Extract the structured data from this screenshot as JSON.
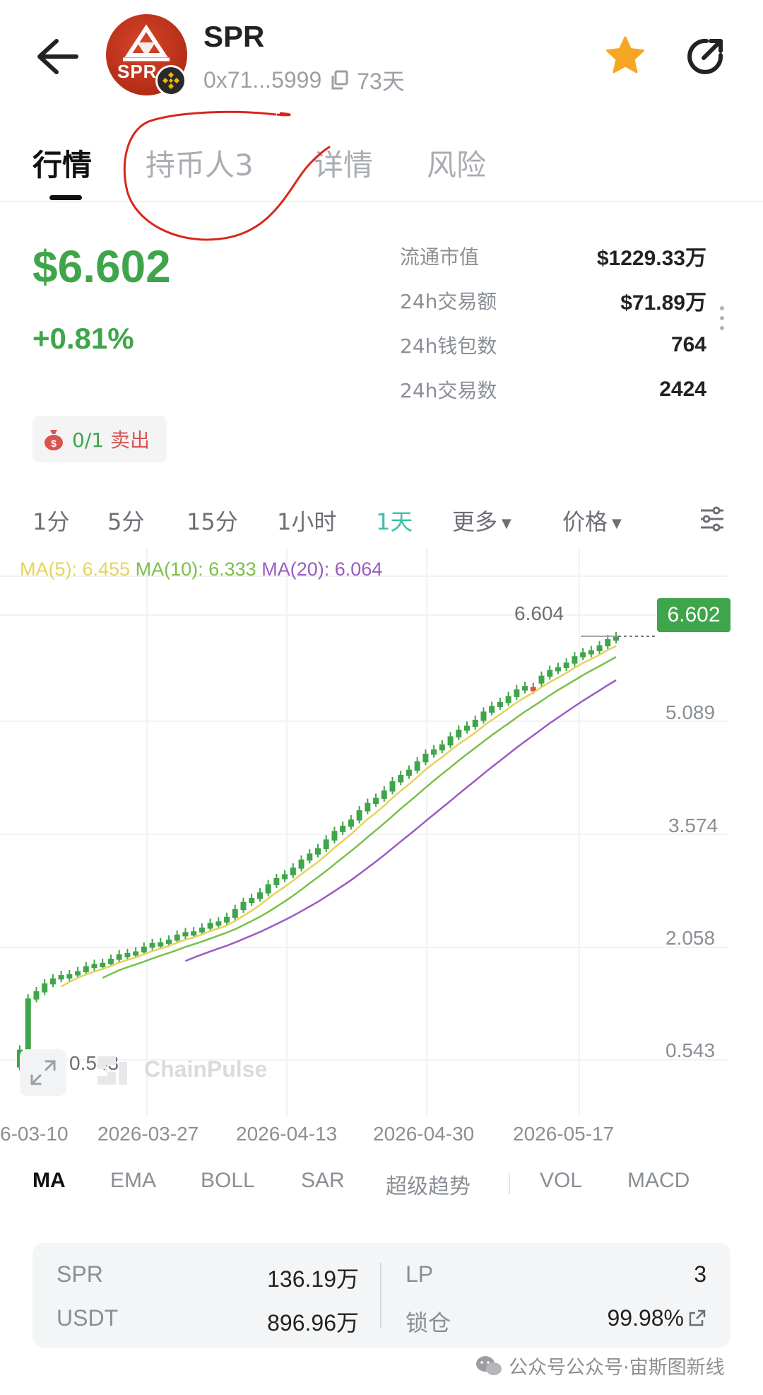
{
  "header": {
    "token_symbol": "SPR",
    "avatar_text": "SPR",
    "address": "0x71...5999",
    "age": "73天"
  },
  "tabs": [
    {
      "label": "行情",
      "active": true
    },
    {
      "label": "持币人3",
      "active": false
    },
    {
      "label": "详情",
      "active": false
    },
    {
      "label": "风险",
      "active": false
    }
  ],
  "price": {
    "current": "$6.602",
    "change": "+0.81%"
  },
  "stats": [
    {
      "label": "流通市值",
      "value": "$1229.33万"
    },
    {
      "label": "24h交易额",
      "value": "$71.89万"
    },
    {
      "label": "24h钱包数",
      "value": "764"
    },
    {
      "label": "24h交易数",
      "value": "2424"
    }
  ],
  "sell_badge": {
    "count": "0/1",
    "label": "卖出"
  },
  "intervals": [
    {
      "label": "1分",
      "active": false
    },
    {
      "label": "5分",
      "active": false
    },
    {
      "label": "15分",
      "active": false
    },
    {
      "label": "1小时",
      "active": false
    },
    {
      "label": "1天",
      "active": true
    },
    {
      "label": "更多",
      "active": false,
      "dropdown": true
    },
    {
      "label": "价格",
      "active": false,
      "dropdown": true
    }
  ],
  "ma_legend": {
    "ma5": "MA(5): 6.455",
    "ma10": "MA(10): 6.333",
    "ma20": "MA(20): 6.064"
  },
  "chart_data": {
    "type": "line",
    "chart_style": "candlestick",
    "interval": "1天",
    "current_price": "6.602",
    "high_marker": "6.604",
    "low_marker": "0.543",
    "y_ticks": [
      "5.089",
      "3.574",
      "2.058",
      "0.543"
    ],
    "ylim": [
      0.3,
      6.9
    ],
    "x_ticks": [
      "6-03-10",
      "2026-03-27",
      "2026-04-13",
      "2026-04-30",
      "2026-05-17"
    ],
    "candle_count": 73,
    "series": [
      {
        "name": "MA(5)",
        "color": "#e6d35a",
        "last": 6.455
      },
      {
        "name": "MA(10)",
        "color": "#7bc04a",
        "last": 6.333
      },
      {
        "name": "MA(20)",
        "color": "#9a5bc4",
        "last": 6.064
      }
    ],
    "close_keypoints": [
      {
        "i": 0,
        "v": 0.8
      },
      {
        "i": 1,
        "v": 1.5
      },
      {
        "i": 3,
        "v": 1.75
      },
      {
        "i": 12,
        "v": 2.12
      },
      {
        "i": 24,
        "v": 2.6
      },
      {
        "i": 34,
        "v": 3.45
      },
      {
        "i": 48,
        "v": 4.85
      },
      {
        "i": 58,
        "v": 5.7
      },
      {
        "i": 66,
        "v": 6.25
      },
      {
        "i": 72,
        "v": 6.602
      }
    ],
    "watermark": "ChainPulse"
  },
  "indicators": [
    {
      "label": "MA",
      "active": true
    },
    {
      "label": "EMA",
      "active": false
    },
    {
      "label": "BOLL",
      "active": false
    },
    {
      "label": "SAR",
      "active": false
    },
    {
      "label": "超级趋势",
      "active": false
    },
    {
      "label": "VOL",
      "active": false
    },
    {
      "label": "MACD",
      "active": false
    }
  ],
  "liquidity": {
    "token_label": "SPR",
    "token_amount": "136.19万",
    "quote_label": "USDT",
    "quote_amount": "896.96万",
    "lp_label": "LP",
    "lp_value": "3",
    "lock_label": "锁仓",
    "lock_value": "99.98%"
  },
  "footer": {
    "watermark": "公众号公众号·宙斯图新线"
  },
  "colors": {
    "up": "#3fa54a",
    "down": "#d9534f",
    "accent": "#3dbfa8",
    "annotation": "#d8261c"
  }
}
